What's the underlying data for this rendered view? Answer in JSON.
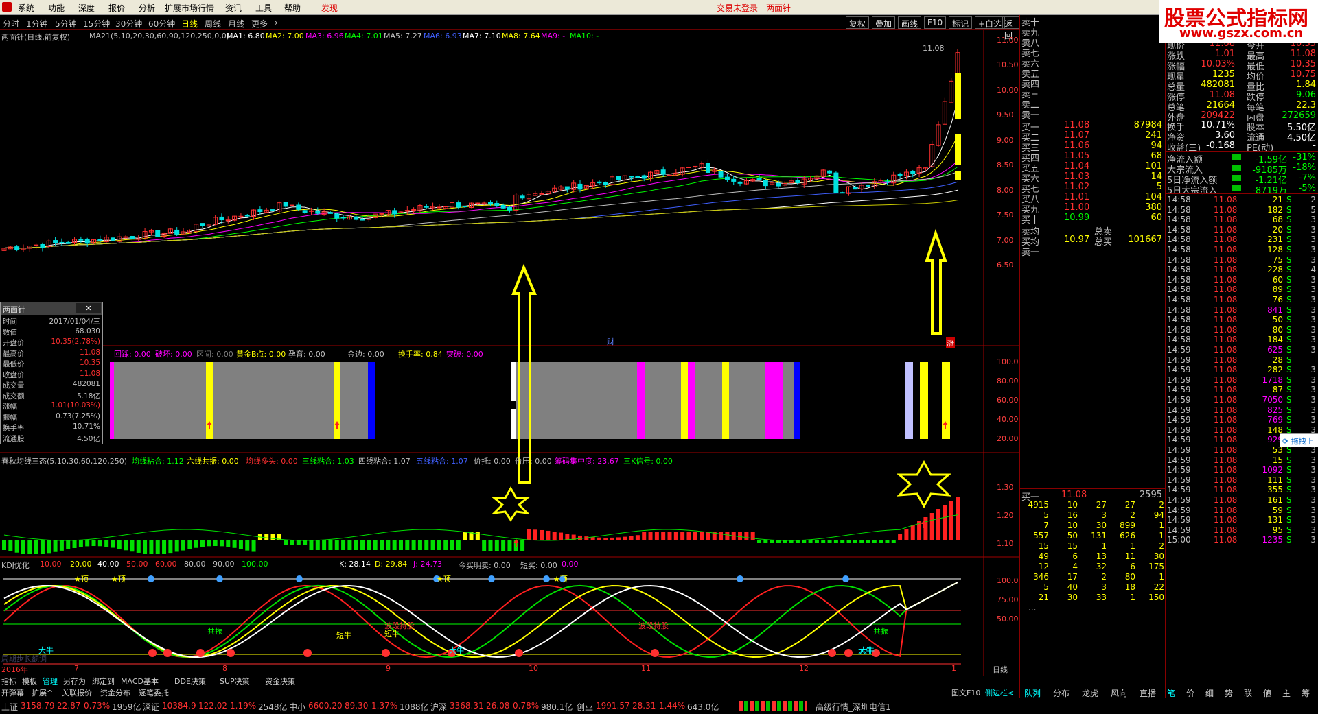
{
  "menu": {
    "items": [
      "系统",
      "功能",
      "深度",
      "报价",
      "分析",
      "扩展市场行情",
      "资讯",
      "工具",
      "帮助"
    ],
    "discover": "发现",
    "login": "交易未登录",
    "title": "两面针",
    "watermark": "股票公式指标网",
    "watermark_url": "www.gszx.com.cn"
  },
  "periods": {
    "items": [
      "分时",
      "1分钟",
      "5分钟",
      "15分钟",
      "30分钟",
      "60分钟",
      "日线",
      "周线",
      "月线",
      "更多"
    ],
    "active": "日线"
  },
  "toolbar": {
    "buttons": [
      "复权",
      "叠加",
      "画线",
      "F10",
      "标记",
      "+自选",
      "返回"
    ]
  },
  "main": {
    "title": "两面针(日线,前复权)",
    "ma_header": "MA21(5,10,20,30,60,90,120,250,0,0)",
    "ma_values": [
      "MA1: 6.80",
      "MA2: 7.00",
      "MA3: 6.96",
      "MA4: 7.01",
      "MA5: 7.27",
      "MA6: 6.93",
      "MA7: 7.10",
      "MA8: 7.64",
      "MA9: -",
      "MA10: -"
    ],
    "ma_colors": [
      "#ffffff",
      "#ffff00",
      "#ff00ff",
      "#00ff00",
      "#c0c0c0",
      "#4060ff",
      "#ffffff",
      "#ffff00",
      "#ff00ff",
      "#00ff00"
    ],
    "yticks": [
      "11.00",
      "10.50",
      "10.00",
      "9.50",
      "9.00",
      "8.50",
      "8.00",
      "7.50",
      "7.00",
      "6.50"
    ],
    "high_label": "11.08",
    "cai": "财",
    "zhang": "涨"
  },
  "ind1": {
    "labels": [
      "回踩: 0.00",
      "破坏: 0.00",
      "区间: 0.00",
      "黄金B点: 0.00",
      "孕育: 0.00",
      "金边: 0.00",
      "换手率: 0.84",
      "突破: 0.00"
    ],
    "yticks": [
      "100.0",
      "80.00",
      "60.00",
      "40.00",
      "20.00"
    ]
  },
  "ind2": {
    "title": "春秋均线三态(5,10,30,60,120,250)",
    "labels": [
      "均线粘合: 1.12",
      "六线共振: 0.00",
      "均线多头: 0.00",
      "三线粘合: 1.03",
      "四线粘合: 1.07",
      "五线粘合: 1.07",
      "价托: 0.00",
      "价压: 0.00",
      "筹码集中度: 23.67",
      "三K信号: 0.00"
    ],
    "yticks": [
      "1.30",
      "1.20",
      "1.10"
    ]
  },
  "ind3": {
    "title": "KDJ优化",
    "levels": [
      "10.00",
      "20.00",
      "40.00",
      "50.00",
      "60.00",
      "80.00",
      "90.00",
      "100.00"
    ],
    "kdj": [
      "K: 28.14",
      "D: 29.84",
      "J: 24.73"
    ],
    "extra": [
      "今买明卖: 0.00",
      "短买: 0.00",
      "0.00"
    ],
    "yticks": [
      "100.0",
      "75.00",
      "50.00"
    ],
    "marks": [
      "顶",
      "顶",
      "顶",
      "顶",
      "共振",
      "短牛",
      "短牛",
      "大牛",
      "大牛",
      "大牛",
      "波段持股",
      "波段持股",
      "共振",
      "大牛"
    ],
    "leftnote": "周期步长额调"
  },
  "dates": [
    "2016年",
    "7",
    "8",
    "9",
    "10",
    "11",
    "12",
    "1"
  ],
  "dateaxis_right": "日线",
  "infobox": {
    "title": "两面针",
    "rows": [
      [
        "时间",
        "2017/01/04/三"
      ],
      [
        "数值",
        "68.030"
      ],
      [
        "开盘价",
        "10.35(2.78%)"
      ],
      [
        "最高价",
        "11.08"
      ],
      [
        "最低价",
        "10.35"
      ],
      [
        "收盘价",
        "11.08"
      ],
      [
        "成交量",
        "482081"
      ],
      [
        "成交额",
        "5.18亿"
      ],
      [
        "涨幅",
        "1.01(10.03%)"
      ],
      [
        "振幅",
        "0.73(7.25%)"
      ],
      [
        "换手率",
        "10.71%"
      ],
      [
        "流通股",
        "4.50亿"
      ]
    ]
  },
  "bottabs": {
    "row1": [
      "指标",
      "模板",
      "管理",
      "另存为",
      "绑定到",
      "MACD基本",
      "DDE决策",
      "SUP决策",
      "资金决策"
    ],
    "row2": [
      "开弹幕",
      "扩展^",
      "关联报价",
      "资金分布",
      "逐笔委托"
    ],
    "right": [
      "图文F10",
      "侧边栏<"
    ]
  },
  "quote": {
    "sell": [
      "卖十",
      "卖九",
      "卖八",
      "卖七",
      "卖六",
      "卖五",
      "卖四",
      "卖三",
      "卖二",
      "卖一"
    ],
    "buy": [
      [
        "买一",
        "11.08",
        "87984"
      ],
      [
        "买二",
        "11.07",
        "241"
      ],
      [
        "买三",
        "11.06",
        "94"
      ],
      [
        "买四",
        "11.05",
        "68"
      ],
      [
        "买五",
        "11.04",
        "101"
      ],
      [
        "买六",
        "11.03",
        "14"
      ],
      [
        "买七",
        "11.02",
        "5"
      ],
      [
        "买八",
        "11.01",
        "104"
      ],
      [
        "买九",
        "11.00",
        "380"
      ],
      [
        "买十",
        "10.99",
        "60"
      ]
    ],
    "avg": [
      [
        "卖均",
        "",
        "总卖",
        ""
      ],
      [
        "买均",
        "10.97",
        "总买",
        "101667"
      ]
    ],
    "sellone": "卖一",
    "stats": [
      [
        "现价",
        "11.08",
        "今开",
        "10.35"
      ],
      [
        "涨跌",
        "1.01",
        "最高",
        "11.08"
      ],
      [
        "涨幅",
        "10.03%",
        "最低",
        "10.35"
      ],
      [
        "现量",
        "1235",
        "均价",
        "10.75"
      ],
      [
        "总量",
        "482081",
        "量比",
        "1.84"
      ],
      [
        "涨停",
        "11.08",
        "跌停",
        "9.06"
      ],
      [
        "总笔",
        "21664",
        "每笔",
        "22.3"
      ],
      [
        "外盘",
        "209422",
        "内盘",
        "272659"
      ]
    ],
    "stats2": [
      [
        "换手",
        "10.71%",
        "股本",
        "5.50亿"
      ],
      [
        "净资",
        "3.60",
        "流通",
        "4.50亿"
      ],
      [
        "收益(三)",
        "-0.168",
        "PE(动)",
        "-"
      ]
    ],
    "flows": [
      [
        "净流入额",
        "-1.59亿",
        "-31%"
      ],
      [
        "大宗流入",
        "-9185万",
        "-18%"
      ],
      [
        "5日净流入额",
        "-1.21亿",
        "-7%"
      ],
      [
        "5日大宗流入",
        "-8719万",
        "-5%"
      ]
    ],
    "ticks": [
      [
        "14:58",
        "11.08",
        "21",
        "S",
        "2"
      ],
      [
        "14:58",
        "11.08",
        "182",
        "S",
        "5"
      ],
      [
        "14:58",
        "11.08",
        "68",
        "S",
        "3"
      ],
      [
        "14:58",
        "11.08",
        "20",
        "S",
        "3"
      ],
      [
        "14:58",
        "11.08",
        "231",
        "S",
        "3"
      ],
      [
        "14:58",
        "11.08",
        "128",
        "S",
        "3"
      ],
      [
        "14:58",
        "11.08",
        "75",
        "S",
        "3"
      ],
      [
        "14:58",
        "11.08",
        "228",
        "S",
        "4"
      ],
      [
        "14:58",
        "11.08",
        "60",
        "S",
        "3"
      ],
      [
        "14:58",
        "11.08",
        "89",
        "S",
        "3"
      ],
      [
        "14:58",
        "11.08",
        "76",
        "S",
        "3"
      ],
      [
        "14:58",
        "11.08",
        "841",
        "S",
        "3"
      ],
      [
        "14:58",
        "11.08",
        "50",
        "S",
        "3"
      ],
      [
        "14:58",
        "11.08",
        "80",
        "S",
        "3"
      ],
      [
        "14:58",
        "11.08",
        "184",
        "S",
        "3"
      ],
      [
        "14:59",
        "11.08",
        "625",
        "S",
        "3"
      ],
      [
        "14:59",
        "11.08",
        "28",
        "S",
        ""
      ],
      [
        "14:59",
        "11.08",
        "282",
        "S",
        "3"
      ],
      [
        "14:59",
        "11.08",
        "1718",
        "S",
        "3"
      ],
      [
        "14:59",
        "11.08",
        "87",
        "S",
        "3"
      ],
      [
        "14:59",
        "11.08",
        "7050",
        "S",
        "3"
      ],
      [
        "14:59",
        "11.08",
        "825",
        "S",
        "3"
      ],
      [
        "14:59",
        "11.08",
        "769",
        "S",
        "3"
      ],
      [
        "14:59",
        "11.08",
        "148",
        "S",
        "3"
      ],
      [
        "14:59",
        "11.08",
        "929",
        "S",
        "3"
      ],
      [
        "14:59",
        "11.08",
        "53",
        "S",
        "3"
      ],
      [
        "14:59",
        "11.08",
        "15",
        "S",
        "3"
      ],
      [
        "14:59",
        "11.08",
        "1092",
        "S",
        "3"
      ],
      [
        "14:59",
        "11.08",
        "111",
        "S",
        "3"
      ],
      [
        "14:59",
        "11.08",
        "355",
        "S",
        "3"
      ],
      [
        "14:59",
        "11.08",
        "161",
        "S",
        "3"
      ],
      [
        "14:59",
        "11.08",
        "59",
        "S",
        "3"
      ],
      [
        "14:59",
        "11.08",
        "131",
        "S",
        "3"
      ],
      [
        "14:59",
        "11.08",
        "95",
        "S",
        "3"
      ],
      [
        "15:00",
        "11.08",
        "1235",
        "S",
        "3"
      ]
    ],
    "queue_head": [
      "买一",
      "11.08",
      "2595"
    ],
    "queue": [
      [
        "4915",
        "10",
        "27",
        "27",
        "2"
      ],
      [
        "5",
        "16",
        "3",
        "2",
        "94"
      ],
      [
        "7",
        "10",
        "30",
        "899",
        "1"
      ],
      [
        "557",
        "50",
        "131",
        "626",
        "1"
      ],
      [
        "15",
        "15",
        "1",
        "1",
        "2"
      ],
      [
        "49",
        "6",
        "13",
        "11",
        "30"
      ],
      [
        "12",
        "4",
        "32",
        "6",
        "175"
      ],
      [
        "346",
        "17",
        "2",
        "80",
        "1"
      ],
      [
        "5",
        "40",
        "3",
        "18",
        "22"
      ],
      [
        "21",
        "30",
        "33",
        "1",
        "150"
      ]
    ],
    "queue_more": "...",
    "floatbtn": "拖拽上",
    "tabs": [
      "队列",
      "分布",
      "龙虎",
      "风向",
      "直播"
    ],
    "tabs2": [
      "笔",
      "价",
      "细",
      "势",
      "联",
      "値",
      "主",
      "筹"
    ]
  },
  "status": {
    "items": [
      [
        "上证",
        "3158.79",
        "22.87",
        "0.73%",
        "1959亿"
      ],
      [
        "深证",
        "10384.9",
        "122.02",
        "1.19%",
        "2548亿"
      ],
      [
        "中小",
        "6600.20",
        "89.30",
        "1.37%",
        "1088亿"
      ],
      [
        "沪深",
        "3368.31",
        "26.08",
        "0.78%",
        "980.1亿"
      ],
      [
        "创业",
        "1991.57",
        "28.31",
        "1.44%",
        "643.0亿"
      ]
    ],
    "right": "高级行情_深圳电信1"
  }
}
